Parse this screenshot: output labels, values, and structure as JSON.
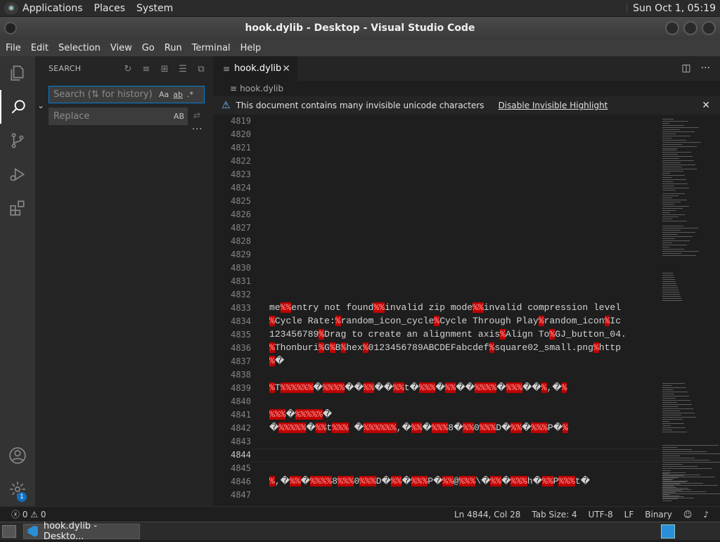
{
  "top_panel": {
    "menus": [
      "Applications",
      "Places",
      "System"
    ],
    "clock": "Sun Oct  1, 05:19"
  },
  "window": {
    "title": "hook.dylib - Desktop - Visual Studio Code"
  },
  "menubar": [
    "File",
    "Edit",
    "Selection",
    "View",
    "Go",
    "Run",
    "Terminal",
    "Help"
  ],
  "sidebar": {
    "title": "SEARCH",
    "search_placeholder": "Search (⇅ for history)",
    "search_options": [
      "Aa",
      "ab",
      ".*"
    ],
    "replace_placeholder": "Replace",
    "replace_option": "AB",
    "more": "···"
  },
  "activity": {
    "accounts_badge": "1"
  },
  "editor": {
    "tab_label": "hook.dylib",
    "breadcrumb": "hook.dylib",
    "banner_text": "This document contains many invisible unicode characters",
    "banner_link": "Disable Invisible Highlight",
    "current_line": 4844,
    "lines": [
      {
        "n": "4819",
        "t": ""
      },
      {
        "n": "4820",
        "t": ""
      },
      {
        "n": "4821",
        "t": ""
      },
      {
        "n": "4822",
        "t": ""
      },
      {
        "n": "4823",
        "t": ""
      },
      {
        "n": "4824",
        "t": ""
      },
      {
        "n": "4825",
        "t": ""
      },
      {
        "n": "4826",
        "t": ""
      },
      {
        "n": "4827",
        "t": ""
      },
      {
        "n": "4828",
        "t": ""
      },
      {
        "n": "4829",
        "t": ""
      },
      {
        "n": "4830",
        "t": ""
      },
      {
        "n": "4831",
        "t": ""
      },
      {
        "n": "4832",
        "t": ""
      },
      {
        "n": "4833",
        "t": "me██entry not found██invalid zip mode██invalid compression level"
      },
      {
        "n": "4834",
        "t": "█Cycle Rate:█random_icon_cycle█Cycle Through Play█random_icon█Ic"
      },
      {
        "n": "4835",
        "t": "123456789█Drag to create an alignment axis█Align To█GJ_button_04."
      },
      {
        "n": "4836",
        "t": "█Thonburi█G█B█hex█0123456789ABCDEFabcdef█square02_small.png█http"
      },
      {
        "n": "4837",
        "t": "█�"
      },
      {
        "n": "4838",
        "t": ""
      },
      {
        "n": "4839",
        "t": "█T██████�████��██��██t�███�██��████�███��█,�█"
      },
      {
        "n": "4840",
        "t": ""
      },
      {
        "n": "4841",
        "t": "███�█████�"
      },
      {
        "n": "4842",
        "t": "�█████�██t███ �██████,�██�███8�██0███D�██�███P�█"
      },
      {
        "n": "4843",
        "t": ""
      },
      {
        "n": "4844",
        "t": ""
      },
      {
        "n": "4845",
        "t": ""
      },
      {
        "n": "4846",
        "t": "█,�██�████8███0███D�██�███P�██@███\\�██�███h�██P███t�"
      },
      {
        "n": "4847",
        "t": ""
      }
    ]
  },
  "status": {
    "problems": "ⓧ 0 ⚠ 0",
    "position": "Ln 4844, Col 28",
    "tab_size": "Tab Size: 4",
    "encoding": "UTF-8",
    "eol": "LF",
    "language": "Binary"
  },
  "taskbar": {
    "item": "hook.dylib - Deskto..."
  },
  "colors": {
    "accent": "#007fd4",
    "banner_icon": "#75beff",
    "invisible_highlight": "#c00000"
  }
}
